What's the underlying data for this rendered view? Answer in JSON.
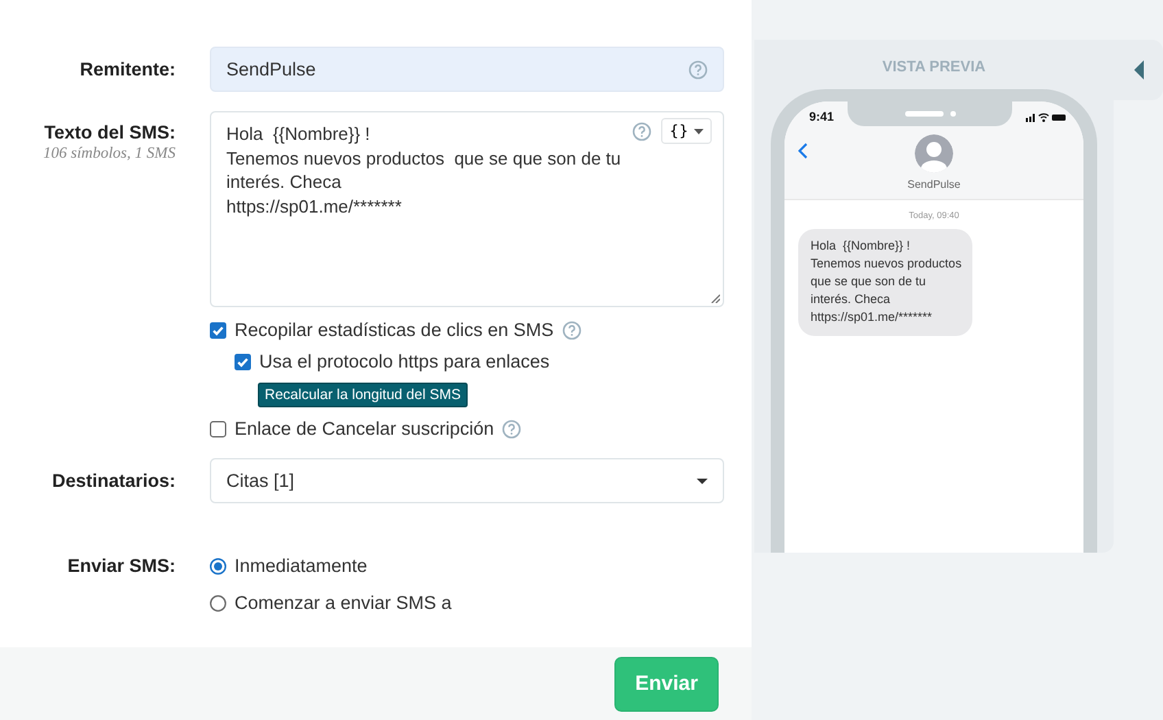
{
  "sender": {
    "label": "Remitente:",
    "value": "SendPulse"
  },
  "message": {
    "label": "Texto del SMS:",
    "counter": "106 símbolos, 1 SMS",
    "variables_button": "{}",
    "lines": [
      "Hola  {{Nombre}} !",
      "Tenemos nuevos productos  que se que son de tu",
      "interés. Checa",
      "https://sp01.me/*******"
    ]
  },
  "options": [
    {
      "kind": "checkbox",
      "label": "Recopilar estadísticas de clics en SMS",
      "checked": true,
      "help": true,
      "children": [
        {
          "kind": "checkbox",
          "label": "Usa el protocolo https para enlaces",
          "checked": true,
          "help": false
        },
        {
          "kind": "button",
          "label": "Recalcular la longitud del SMS"
        }
      ]
    },
    {
      "kind": "checkbox",
      "label": "Enlace de Cancelar suscripción",
      "checked": false,
      "help": true
    }
  ],
  "recipients": {
    "label": "Destinatarios:",
    "value": "Citas [1]"
  },
  "send": {
    "label": "Enviar SMS:",
    "options": [
      {
        "label": "Inmediatamente",
        "selected": true
      },
      {
        "label": "Comenzar a enviar SMS a",
        "selected": false
      }
    ]
  },
  "submit": "Enviar",
  "preview": {
    "title": "VISTA PREVIA",
    "time": "9:41",
    "contact": "SendPulse",
    "timestamp": "Today, 09:40",
    "bubble_lines": [
      "Hola  {{Nombre}} !",
      "Tenemos nuevos productos",
      "que se que son de tu",
      "interés. Checa",
      "https://sp01.me/*******"
    ]
  }
}
